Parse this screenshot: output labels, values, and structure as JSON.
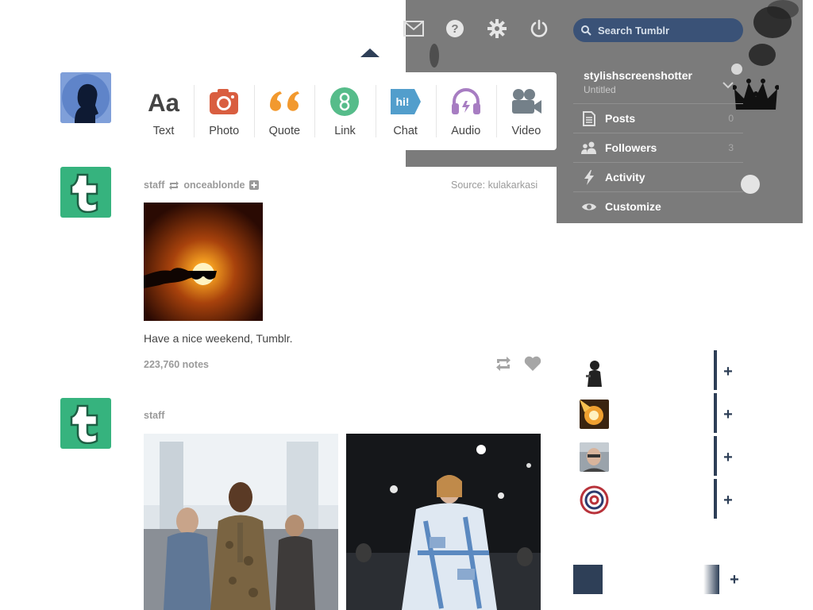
{
  "header": {
    "icons": [
      "mail-icon",
      "help-icon",
      "gear-icon",
      "power-icon"
    ]
  },
  "search": {
    "placeholder": "Search Tumblr"
  },
  "post_types": [
    {
      "label": "Text",
      "icon": "text-icon",
      "color": "#444444"
    },
    {
      "label": "Photo",
      "icon": "camera-icon",
      "color": "#d95e40"
    },
    {
      "label": "Quote",
      "icon": "quote-icon",
      "color": "#f2992e"
    },
    {
      "label": "Link",
      "icon": "link-icon",
      "color": "#56bc8a"
    },
    {
      "label": "Chat",
      "icon": "chat-icon",
      "color": "#529ecc"
    },
    {
      "label": "Audio",
      "icon": "headphones-icon",
      "color": "#a77dc2"
    },
    {
      "label": "Video",
      "icon": "video-camera-icon",
      "color": "#748089"
    }
  ],
  "account": {
    "name": "stylishscreenshotter",
    "subtitle": "Untitled",
    "menu": [
      {
        "label": "Posts",
        "count": "0",
        "icon": "document-icon"
      },
      {
        "label": "Followers",
        "count": "3",
        "icon": "followers-icon"
      },
      {
        "label": "Activity",
        "count": "",
        "icon": "lightning-icon"
      },
      {
        "label": "Customize",
        "count": "",
        "icon": "eye-icon"
      }
    ]
  },
  "posts": [
    {
      "author": "staff",
      "reblogged_from": "onceablonde",
      "source_label": "Source:",
      "source_name": "kulakarkasi",
      "caption": "Have a nice weekend, Tumblr.",
      "notes": "223,760 notes"
    },
    {
      "author": "staff"
    }
  ],
  "colors": {
    "navy": "#2e3f57",
    "tumblr_green": "#36b37e",
    "sidebar_grey": "#7b7b7b"
  }
}
